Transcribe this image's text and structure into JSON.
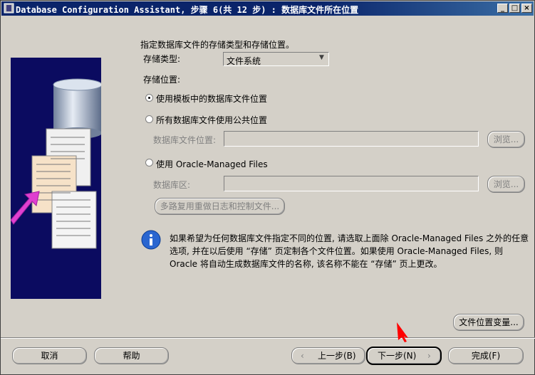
{
  "window": {
    "title": "Database Configuration Assistant, 步骤 6(共 12 步) : 数据库文件所在位置",
    "controls": {
      "minimize": "_",
      "maximize": "□",
      "close": "×"
    }
  },
  "content": {
    "heading": "指定数据库文件的存储类型和存储位置。",
    "storage_type_label": "存储类型:",
    "storage_type_value": "文件系统",
    "storage_location_label": "存储位置:",
    "options": {
      "template": "使用模板中的数据库文件位置",
      "common": "所有数据库文件使用公共位置",
      "omf": "使用 Oracle-Managed Files"
    },
    "selected_option": "template",
    "db_file_location_label": "数据库文件位置:",
    "db_area_label": "数据库区:",
    "browse": "浏览...",
    "multiplex_button": "多路复用重做日志和控制文件...",
    "info_text_lines": [
      "如果希望为任何数据库文件指定不同的位置, 请选取上面除 Oracle-Managed Files 之外的任意",
      "选项, 并在以后使用 “存储” 页定制各个文件位置。如果使用 Oracle-Managed Files, 则",
      "Oracle 将自动生成数据库文件的名称, 该名称不能在 “存储” 页上更改。"
    ],
    "file_location_variables": "文件位置变量..."
  },
  "footer": {
    "cancel": "取消",
    "help": "帮助",
    "back": "上一步(B)",
    "next": "下一步(N)",
    "finish": "完成(F)"
  },
  "colors": {
    "titlebar": "#0a246a",
    "face": "#d4d0c8",
    "pointer": "#ff0000"
  }
}
